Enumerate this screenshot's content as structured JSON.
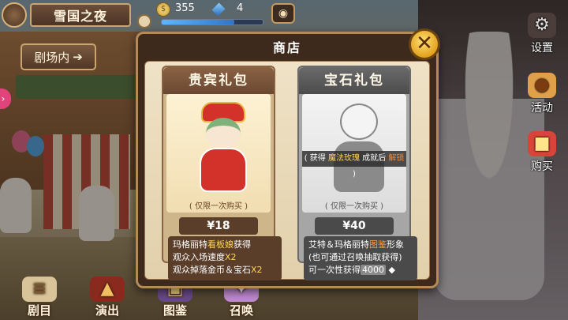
{
  "hud": {
    "location_title": "雪国之夜",
    "coins": "355",
    "gems": "4",
    "energy_fill": 0.72
  },
  "buttons": {
    "theater": "剧场内",
    "theater_arrow": "➔",
    "settings": "设置",
    "events": "活动",
    "buy": "购买"
  },
  "bottom_nav": {
    "script": "剧目",
    "perform": "演出",
    "catalog": "图鉴",
    "summon": "召唤"
  },
  "shop": {
    "title": "商店",
    "close": "✕",
    "vip_pack": {
      "title": "贵宾礼包",
      "limit": "( 仅限一次购买 )",
      "price": "¥18",
      "desc_line1_a": "玛格丽特",
      "desc_line1_hl": "看板娘",
      "desc_line1_b": "获得",
      "desc_line2_a": "观众入场速度",
      "desc_line2_hl": "X2",
      "desc_line3_a": "观众掉落金币＆宝石",
      "desc_line3_hl": "X2"
    },
    "gem_pack": {
      "title": "宝石礼包",
      "unlock_a": "( 获得 ",
      "unlock_hl1": "魔法玫瑰",
      "unlock_b": " 成就后 ",
      "unlock_hl2": "解锁",
      "unlock_c": " )",
      "limit": "( 仅限一次购买 )",
      "price": "¥40",
      "desc_line1_a": "艾特＆玛格丽特",
      "desc_line1_hl": "图鉴",
      "desc_line1_b": "形象",
      "desc_line2": "(也可通过召唤抽取获得)",
      "desc_line3_a": "可一次性获得",
      "desc_line3_num": "4000"
    }
  },
  "colors": {
    "dialog_frame": "#3d2a1d",
    "dialog_border": "#b68a57",
    "close_button": "#e3a11b",
    "highlight_yellow": "#ffd45a",
    "highlight_orange": "#ff9b3c"
  },
  "icons": {
    "menu": "circle-menu-icon",
    "clock": "clock-icon",
    "coin": "coin-icon",
    "gem": "gem-icon",
    "camera": "camera-icon",
    "settings": "gear-icon",
    "events": "monkey-icon",
    "buy": "gift-box-icon"
  }
}
